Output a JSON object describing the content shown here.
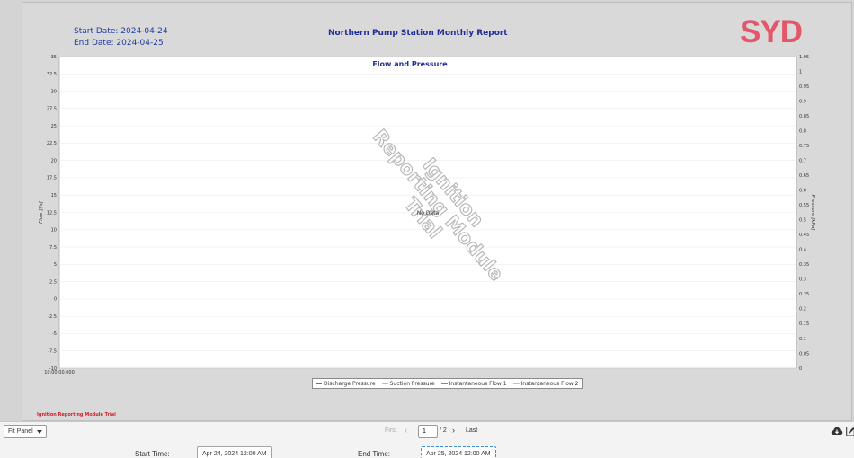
{
  "report": {
    "start_date_label": "Start Date:",
    "start_date": "2024-04-24",
    "end_date_label": "End Date:",
    "end_date": "2024-04-25",
    "title": "Northern Pump Station Monthly Report",
    "logo_text": "SYD",
    "trial_footer": "Ignition Reporting Module Trial"
  },
  "chart_data": {
    "type": "line",
    "title": "Flow and Pressure",
    "no_data_text": "No Data",
    "watermark_lines": [
      "Ignition",
      "Reporting Module",
      "Trial"
    ],
    "xlabel": "",
    "x_ticks": [
      "10:00:00.000"
    ],
    "y_left": {
      "label": "Flow [l/s]",
      "ylim": [
        -10,
        35
      ],
      "ticks": [
        "35",
        "32.5",
        "30",
        "27.5",
        "25",
        "22.5",
        "20",
        "17.5",
        "15",
        "12.5",
        "10",
        "7.5",
        "5",
        "2.5",
        "0",
        "-2.5",
        "-5",
        "-7.5",
        "-10"
      ]
    },
    "y_right": {
      "label": "Pressure [kPa]",
      "ylim": [
        0,
        1.05
      ],
      "ticks": [
        "1.05",
        "1",
        "0.95",
        "0.9",
        "0.85",
        "0.8",
        "0.75",
        "0.7",
        "0.65",
        "0.6",
        "0.55",
        "0.5",
        "0.45",
        "0.4",
        "0.35",
        "0.3",
        "0.25",
        "0.2",
        "0.15",
        "0.1",
        "0.05",
        "0"
      ]
    },
    "grid": true,
    "legend_position": "bottom",
    "series": [
      {
        "name": "Discharge Pressure",
        "color": "#c44a5a",
        "values": []
      },
      {
        "name": "Suction Pressure",
        "color": "#e8b96a",
        "values": []
      },
      {
        "name": "Instantaneous Flow 1",
        "color": "#4caf50",
        "values": []
      },
      {
        "name": "Instantaneous Flow 2",
        "color": "#9ecfe6",
        "values": []
      }
    ]
  },
  "viewer": {
    "fit_option": "Fit Panel",
    "pager_first": "First",
    "current_page": "1",
    "page_total": "/ 2",
    "pager_last": "Last",
    "start_time_label": "Start Time:",
    "start_time_value": "Apr 24, 2024 12:00 AM",
    "end_time_label": "End Time:",
    "end_time_value": "Apr 25, 2024 12:00 AM"
  },
  "icons": {
    "download": "cloud-download-icon",
    "edit": "edit-icon",
    "prev": "chevron-left-icon",
    "next": "chevron-right-icon",
    "dropdown": "caret-down-icon"
  }
}
